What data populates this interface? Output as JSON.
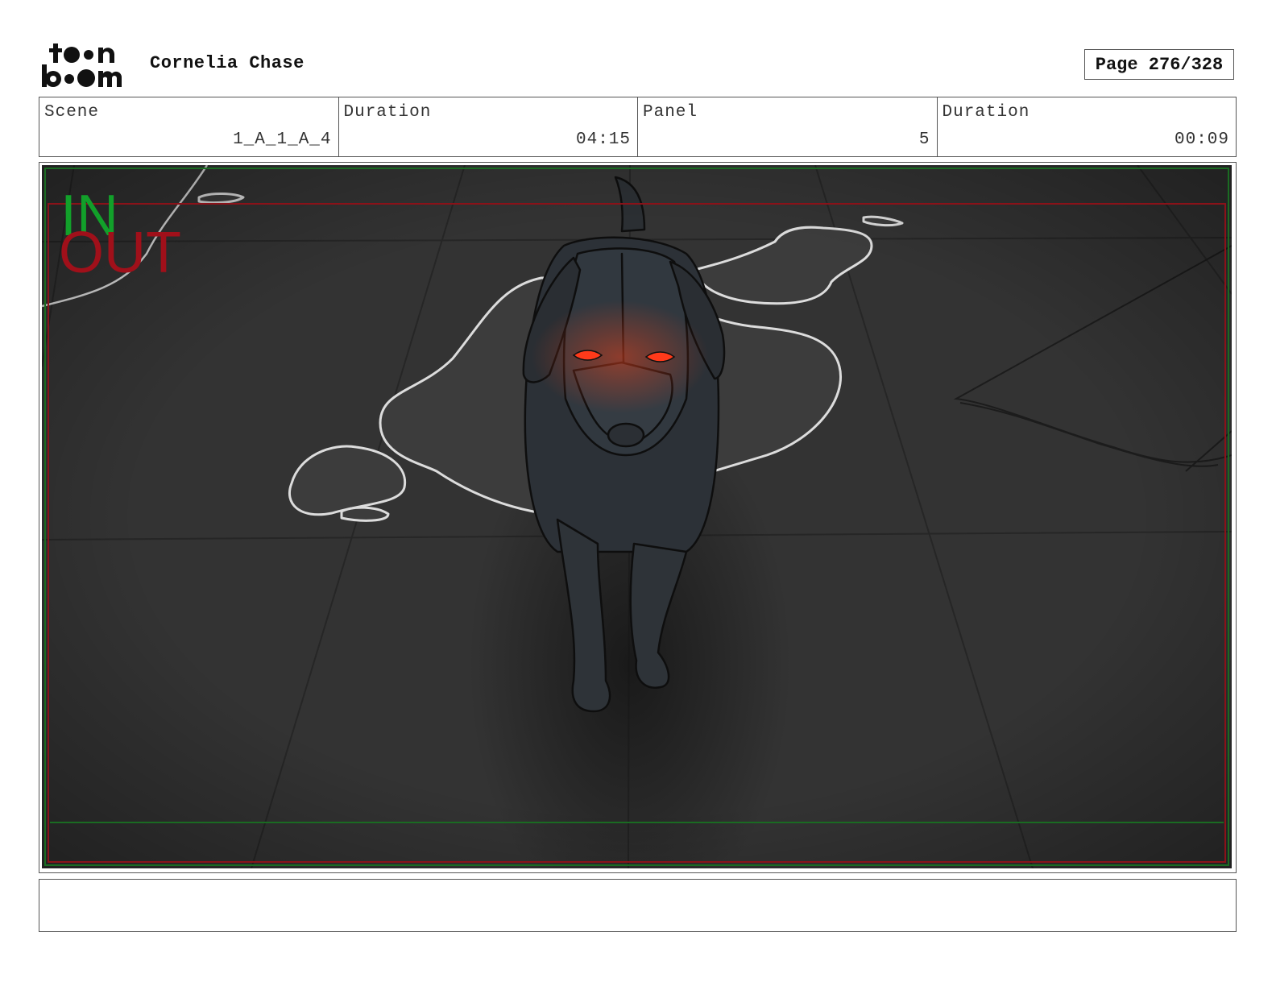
{
  "header": {
    "logo_text": "toon boom",
    "project_title": "Cornelia Chase",
    "page": "Page 276/328"
  },
  "info": {
    "scene_label": "Scene",
    "scene_value": "1_A_1_A_4",
    "scene_duration_label": "Duration",
    "scene_duration_value": "04:15",
    "panel_label": "Panel",
    "panel_value": "5",
    "panel_duration_label": "Duration",
    "panel_duration_value": "00:09"
  },
  "panel": {
    "in_marker": "IN",
    "out_marker": "OUT",
    "in_color": "#12a02a",
    "out_color": "#a0101a"
  },
  "notes": {
    "text": ""
  }
}
